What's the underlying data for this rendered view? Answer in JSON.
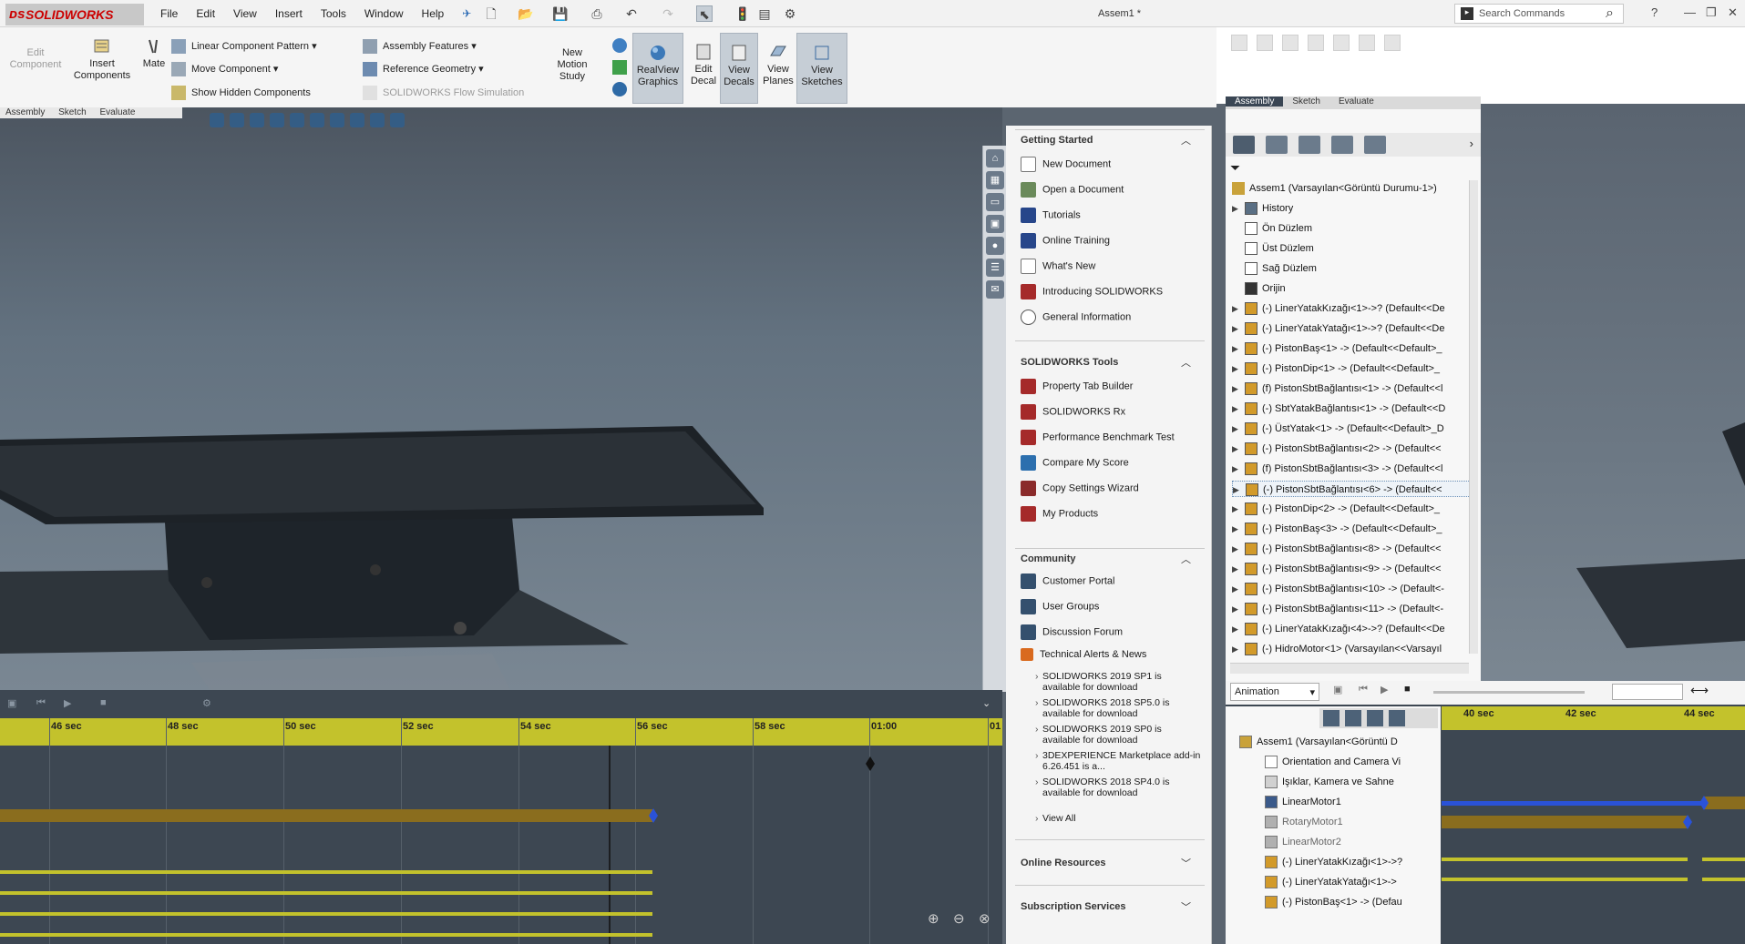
{
  "app": {
    "logo_text": "SOLIDWORKS",
    "document_title": "Assem1 *",
    "menu": [
      "File",
      "Edit",
      "View",
      "Insert",
      "Tools",
      "Window",
      "Help"
    ],
    "search_placeholder": "Search Commands"
  },
  "commands": {
    "edit_component": "Edit\nComponent",
    "insert_components": "Insert\nComponents",
    "mate": "Mate",
    "linear_pattern": "Linear Component Pattern",
    "move_component": "Move Component",
    "show_hidden": "Show Hidden Components",
    "assembly_features": "Assembly Features",
    "reference_geometry": "Reference Geometry",
    "flow_simulation": "SOLIDWORKS Flow Simulation",
    "new_motion_study": "New\nMotion\nStudy",
    "realview": "RealView\nGraphics",
    "edit_decal": "Edit\nDecal",
    "view_decals": "View\nDecals",
    "view_planes": "View\nPlanes",
    "view_sketches": "View\nSketches"
  },
  "cm_tabs": [
    "Assembly",
    "Sketch",
    "Evaluate"
  ],
  "task_pane": {
    "getting_started": {
      "title": "Getting Started",
      "items": [
        "New Document",
        "Open a Document",
        "Tutorials",
        "Online Training",
        "What's New",
        "Introducing SOLIDWORKS",
        "General Information"
      ]
    },
    "tools": {
      "title": "SOLIDWORKS Tools",
      "items": [
        "Property Tab Builder",
        "SOLIDWORKS Rx",
        "Performance Benchmark Test",
        "Compare My Score",
        "Copy Settings Wizard",
        "My Products"
      ]
    },
    "community": {
      "title": "Community",
      "items": [
        "Customer Portal",
        "User Groups",
        "Discussion Forum",
        "Technical Alerts & News"
      ],
      "news": [
        "SOLIDWORKS 2019 SP1 is available for download",
        "SOLIDWORKS 2018 SP5.0 is available for download",
        "SOLIDWORKS 2019 SP0 is available for download",
        "3DEXPERIENCE Marketplace add-in 6.26.451 is a...",
        "SOLIDWORKS 2018 SP4.0 is available for download"
      ],
      "view_all": "View All"
    },
    "online_resources": "Online Resources",
    "subscription_services": "Subscription Services"
  },
  "tree": {
    "root": "Assem1  (Varsayılan<Görüntü Durumu-1>)",
    "items": [
      {
        "label": "History",
        "icon": "history-icon"
      },
      {
        "label": "Ön Düzlem",
        "icon": "plane-icon"
      },
      {
        "label": "Üst Düzlem",
        "icon": "plane-icon"
      },
      {
        "label": "Sağ Düzlem",
        "icon": "plane-icon"
      },
      {
        "label": "Orijin",
        "icon": "origin-icon"
      },
      {
        "label": "(-) LinerYatakKızağı<1>->? (Default<<De",
        "icon": "part-icon"
      },
      {
        "label": "(-) LinerYatakYatağı<1>->? (Default<<De",
        "icon": "part-icon"
      },
      {
        "label": "(-) PistonBaş<1> -> (Default<<Default>_",
        "icon": "part-icon"
      },
      {
        "label": "(-) PistonDip<1> -> (Default<<Default>_",
        "icon": "part-icon"
      },
      {
        "label": "(f) PistonSbtBağlantısı<1> -> (Default<<l",
        "icon": "part-icon"
      },
      {
        "label": "(-) SbtYatakBağlantısı<1> -> (Default<<D",
        "icon": "part-icon"
      },
      {
        "label": "(-) ÜstYatak<1> -> (Default<<Default>_D",
        "icon": "part-icon"
      },
      {
        "label": "(-) PistonSbtBağlantısı<2> -> (Default<<",
        "icon": "part-icon"
      },
      {
        "label": "(f) PistonSbtBağlantısı<3> -> (Default<<l",
        "icon": "part-icon"
      },
      {
        "label": "(-) PistonSbtBağlantısı<6> -> (Default<<",
        "icon": "part-icon"
      },
      {
        "label": "(-) PistonDip<2> -> (Default<<Default>_",
        "icon": "part-icon"
      },
      {
        "label": "(-) PistonBaş<3> -> (Default<<Default>_",
        "icon": "part-icon"
      },
      {
        "label": "(-) PistonSbtBağlantısı<8> -> (Default<<",
        "icon": "part-icon"
      },
      {
        "label": "(-) PistonSbtBağlantısı<9> -> (Default<<",
        "icon": "part-icon"
      },
      {
        "label": "(-) PistonSbtBağlantısı<10> -> (Default<-",
        "icon": "part-icon"
      },
      {
        "label": "(-) PistonSbtBağlantısı<11> -> (Default<-",
        "icon": "part-icon"
      },
      {
        "label": "(-) LinerYatakKızağı<4>->? (Default<<De",
        "icon": "part-icon"
      },
      {
        "label": "(-) HidroMotor<1> (Varsayılan<<Varsayıl",
        "icon": "part-icon"
      }
    ]
  },
  "motion": {
    "ticks": [
      "46 sec",
      "48 sec",
      "50 sec",
      "52 sec",
      "54 sec",
      "56 sec",
      "58 sec",
      "01:00",
      "01"
    ],
    "study_type": "Animation",
    "right_ticks": [
      "40 sec",
      "42 sec",
      "44 sec"
    ],
    "tree": [
      "Assem1  (Varsayılan<Görüntü D",
      "Orientation and Camera Vi",
      "Işıklar, Kamera ve Sahne",
      "LinearMotor1",
      "RotaryMotor1",
      "LinearMotor2",
      "(-) LinerYatakKızağı<1>->?",
      "(-) LinerYatakYatağı<1>->",
      "(-) PistonBaş<1> -> (Defau"
    ]
  },
  "colors": {
    "timeline_yellow": "#c3c22c",
    "bar_brown": "#8a6d1e",
    "key_blue": "#2a52d8"
  }
}
